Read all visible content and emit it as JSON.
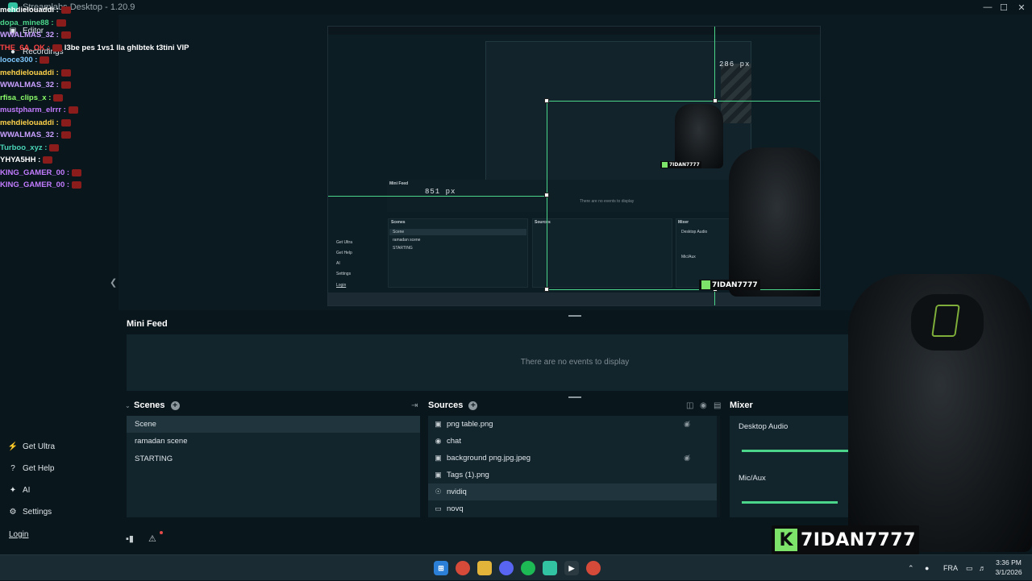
{
  "window": {
    "title": "Streamlabs Desktop - 1.20.9",
    "minimize": "—",
    "maximize": "☐",
    "close": "✕"
  },
  "nav": {
    "editor": "Editor",
    "recordings": "Recordings",
    "get_ultra": "Get Ultra",
    "get_help": "Get Help",
    "ai": "AI",
    "settings": "Settings",
    "login": "Login"
  },
  "chat": [
    {
      "user": "mehdielouaddi :",
      "color": "#ffffff",
      "msg": ""
    },
    {
      "user": "dopa_mine88 :",
      "color": "#4ad58a",
      "msg": ""
    },
    {
      "user": "WWALMAS_32 :",
      "color": "#c9a0ff",
      "msg": ""
    },
    {
      "user": "THE_6A_OK :",
      "color": "#ff4444",
      "msg": "l3be pes 1vs1 lla ghlbtek t3tini VIP"
    },
    {
      "user": "looce300 :",
      "color": "#7fc9ff",
      "msg": ""
    },
    {
      "user": "mehdielouaddi :",
      "color": "#ffd24a",
      "msg": ""
    },
    {
      "user": "WWALMAS_32 :",
      "color": "#c9a0ff",
      "msg": ""
    },
    {
      "user": "rfisa_clips_x :",
      "color": "#8cff6a",
      "msg": ""
    },
    {
      "user": "mustpharm_elrrr :",
      "color": "#c37cff",
      "msg": ""
    },
    {
      "user": "mehdielouaddi :",
      "color": "#ffd24a",
      "msg": ""
    },
    {
      "user": "WWALMAS_32 :",
      "color": "#c9a0ff",
      "msg": ""
    },
    {
      "user": "Turboo_xyz :",
      "color": "#4ad5b8",
      "msg": ""
    },
    {
      "user": "YHYA5HH :",
      "color": "#ffffff",
      "msg": ""
    },
    {
      "user": "KING_GAMER_00 :",
      "color": "#c37cff",
      "msg": ""
    },
    {
      "user": "KING_GAMER_00 :",
      "color": "#c37cff",
      "msg": ""
    }
  ],
  "preview": {
    "measure_top": "286 px",
    "measure_left": "851 px",
    "inner_minifeed": "Mini Feed",
    "inner_empty": "There are no events to display",
    "inner_scenes": "Scenes",
    "inner_sources": "Sources",
    "inner_mixer": "Mixer",
    "inner_scene_1": "Scene",
    "inner_scene_2": "ramadan scene",
    "inner_scene_3": "STARTING",
    "inner_desktop_audio": "Desktop Audio",
    "inner_mic": "Mic/Aux",
    "inner_get_ultra": "Get Ultra",
    "inner_get_help": "Get Help",
    "inner_ai": "AI",
    "inner_settings": "Settings",
    "inner_login": "Login",
    "inner_brand": "7IDAN7777",
    "inner_brand_small": "7IDAN7777"
  },
  "minifeed": {
    "title": "Mini Feed",
    "empty": "There are no events to display"
  },
  "scenes": {
    "title": "Scenes",
    "items": [
      "Scene",
      "ramadan scene",
      "STARTING"
    ]
  },
  "sources": {
    "title": "Sources",
    "items": [
      {
        "label": "png table.png",
        "icon": "image-icon",
        "hidden": true
      },
      {
        "label": "chat",
        "icon": "globe-icon",
        "hidden": false
      },
      {
        "label": "background png.jpg.jpeg",
        "icon": "image-icon",
        "hidden": true
      },
      {
        "label": "Tags (1).png",
        "icon": "image-icon",
        "hidden": false
      },
      {
        "label": "nvidiq",
        "icon": "webcam-icon",
        "hidden": false
      },
      {
        "label": "novq",
        "icon": "monitor-icon",
        "hidden": false
      }
    ]
  },
  "mixer": {
    "title": "Mixer",
    "channels": [
      {
        "label": "Desktop Audio",
        "level": 0.38
      },
      {
        "label": "Mic/Aux",
        "level": 0.33
      }
    ]
  },
  "brand": {
    "k": "K",
    "name": "7IDAN7777"
  },
  "taskbar": {
    "lang": "FRA",
    "time": "3:36 PM",
    "date": "3/1/2026"
  },
  "colors": {
    "accent": "#4ad58a",
    "background": "#09161c",
    "panel": "#12242c"
  }
}
